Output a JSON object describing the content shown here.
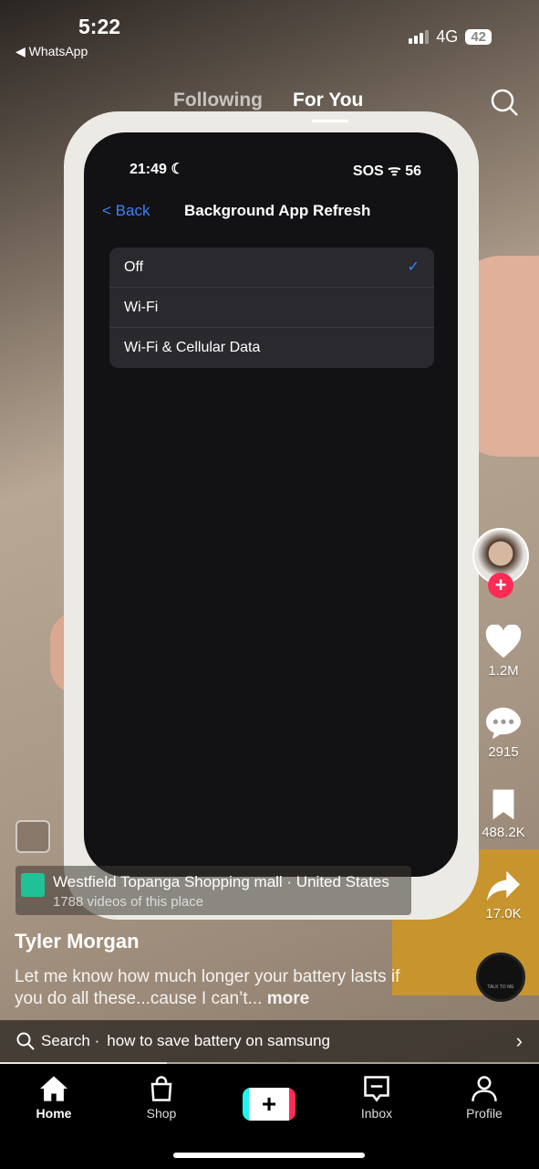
{
  "status_bar": {
    "time": "5:22",
    "back_app": "◀ WhatsApp",
    "network": "4G",
    "battery": "42"
  },
  "feed_tabs": {
    "following": "Following",
    "for_you": "For You",
    "active": "For You"
  },
  "video": {
    "phone_status": {
      "time": "21:49 ☾",
      "right": "SOS ᯤ 56"
    },
    "nav_back": "< Back",
    "nav_title": "Background App Refresh",
    "options": [
      {
        "label": "Off",
        "checked": true
      },
      {
        "label": "Wi-Fi"
      },
      {
        "label": "Wi-Fi & Cellular Data"
      }
    ],
    "checkmark": "✓"
  },
  "actions": {
    "likes": "1.2M",
    "comments": "2915",
    "saves": "488.2K",
    "shares": "17.0K",
    "follow_plus": "+"
  },
  "location": {
    "name": "Westfield Topanga Shopping mall · United States",
    "subtitle": "1788 videos of this place"
  },
  "author": "Tyler Morgan",
  "caption": {
    "text": "Let me know how much longer your battery lasts if you do all these...cause I can’t... ",
    "more": "more"
  },
  "music_disc_label": "TALK TO ME",
  "search_bar": {
    "prefix": "Search ·",
    "query": "how to save battery on samsung",
    "chevron": "›"
  },
  "video_progress": 0.31,
  "bottom_nav": {
    "home": "Home",
    "shop": "Shop",
    "create": "+",
    "inbox": "Inbox",
    "profile": "Profile",
    "active": "Home"
  },
  "colors": {
    "accent": "#fe2c55",
    "cyan": "#25f4ee",
    "location_pin": "#20c197",
    "ios_blue": "#3b82f6"
  }
}
